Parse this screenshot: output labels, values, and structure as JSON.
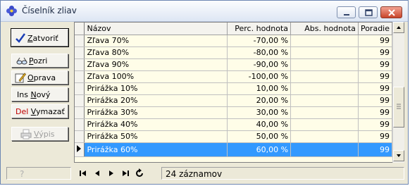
{
  "window": {
    "title": "Číselník zliav"
  },
  "buttons": {
    "zatvorit": {
      "label_pre": "",
      "label_u": "Z",
      "label_post": "atvoriť"
    },
    "pozri": {
      "label_pre": "",
      "label_u": "P",
      "label_post": "ozri"
    },
    "oprava": {
      "label_pre": "",
      "label_u": "O",
      "label_post": "prava"
    },
    "novy": {
      "key": "Ins",
      "label_u": "N",
      "label_post": "ový"
    },
    "vymazat": {
      "key": "Del",
      "label_u": "V",
      "label_post": "ymazať"
    },
    "vypis": {
      "label_pre": "",
      "label_u": "V",
      "label_post": "ýpis"
    }
  },
  "table": {
    "columns": [
      "Názov",
      "Perc. hodnota",
      "Abs. hodnota",
      "Poradie"
    ],
    "rows": [
      [
        "Zľava 70%",
        "-70,00 %",
        "",
        "99"
      ],
      [
        "Zľava 80%",
        "-80,00 %",
        "",
        "99"
      ],
      [
        "Zľava 90%",
        "-90,00 %",
        "",
        "99"
      ],
      [
        "Zľava 100%",
        "-100,00 %",
        "",
        "99"
      ],
      [
        "Prirážka 10%",
        "10,00 %",
        "",
        "99"
      ],
      [
        "Prirážka 20%",
        "20,00 %",
        "",
        "99"
      ],
      [
        "Prirážka 30%",
        "30,00 %",
        "",
        "99"
      ],
      [
        "Prirážka 40%",
        "40,00 %",
        "",
        "99"
      ],
      [
        "Prirážka 50%",
        "50,00 %",
        "",
        "99"
      ],
      [
        "Prirážka 60%",
        "60,00 %",
        "",
        "99"
      ]
    ],
    "selected_row": 9,
    "selection_color": "#3399ff",
    "row_background": "#fffde8"
  },
  "status": {
    "help_icon": "question-icon",
    "record_count": "24 záznamov"
  }
}
